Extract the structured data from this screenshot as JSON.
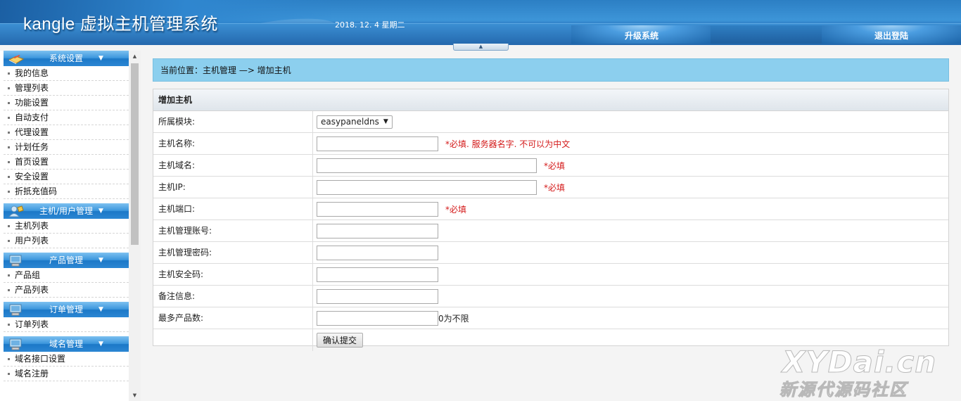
{
  "header": {
    "title": "kangle 虚拟主机管理系统",
    "date": "2018. 12. 4  星期二",
    "upgrade_label": "升级系统",
    "logout_label": "退出登陆"
  },
  "sidebar": {
    "groups": [
      {
        "title": "系统设置",
        "icon": "book-icon",
        "items": [
          "我的信息",
          "管理列表",
          "功能设置",
          "自动支付",
          "代理设置",
          "计划任务",
          "首页设置",
          "安全设置",
          "折扺充值码"
        ]
      },
      {
        "title": "主机/用户管理",
        "icon": "users-icon",
        "items": [
          "主机列表",
          "用户列表"
        ]
      },
      {
        "title": "产品管理",
        "icon": "monitor-icon",
        "items": [
          "产品组",
          "产品列表"
        ]
      },
      {
        "title": "订单管理",
        "icon": "monitor-icon",
        "items": [
          "订单列表"
        ]
      },
      {
        "title": "域名管理",
        "icon": "monitor-icon",
        "items": [
          "域名接口设置",
          "域名注册"
        ]
      }
    ]
  },
  "breadcrumb": "当前位置：主机管理 —> 增加主机",
  "form": {
    "title": "增加主机",
    "module": {
      "label": "所属模块:",
      "value": "easypaneldns"
    },
    "host_name": {
      "label": "主机名称:",
      "value": "",
      "hint": "*必填. 服务器名字. 不可以为中文"
    },
    "host_domain": {
      "label": "主机域名:",
      "value": "",
      "hint": "*必填"
    },
    "host_ip": {
      "label": "主机IP:",
      "value": "",
      "hint": "*必填"
    },
    "host_port": {
      "label": "主机端口:",
      "value": "",
      "hint": "*必填"
    },
    "admin_account": {
      "label": "主机管理账号:",
      "value": ""
    },
    "admin_password": {
      "label": "主机管理密码:",
      "value": ""
    },
    "security_code": {
      "label": "主机安全码:",
      "value": ""
    },
    "remark": {
      "label": "备注信息:",
      "value": ""
    },
    "max_products": {
      "label": "最多产品数:",
      "value": "",
      "suffix": "0为不限"
    },
    "submit_label": "确认提交"
  },
  "watermark": {
    "line1": "XYDai.cn",
    "line2": "新源代源码社区"
  },
  "colors": {
    "header_blue": "#2c7fc4",
    "breadcrumb_bg": "#8ccfee",
    "hint_red": "#d41a1a"
  }
}
